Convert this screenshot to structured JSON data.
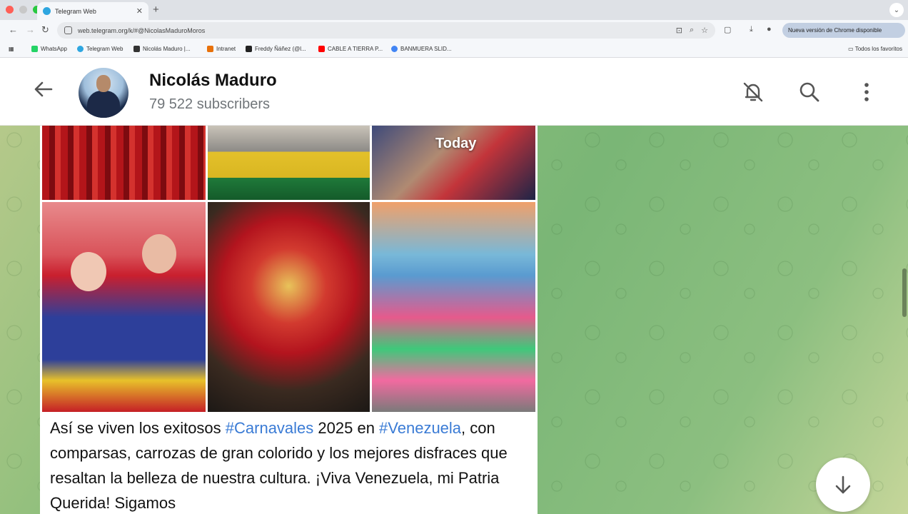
{
  "browser": {
    "tab_title": "Telegram Web",
    "url": "web.telegram.org/k/#@NicolasMaduroMoros",
    "update_button": "Nueva versión de Chrome disponible",
    "bookmarks": [
      {
        "label": "WhatsApp",
        "color": "#25d366"
      },
      {
        "label": "Telegram Web",
        "color": "#2ea6e0"
      },
      {
        "label": "Nicolás Maduro |...",
        "color": "#333333"
      },
      {
        "label": "Intranet",
        "color": "#e8710a"
      },
      {
        "label": "Freddy Ñáñez (@l...",
        "color": "#222222"
      },
      {
        "label": "CABLE A TIERRA P...",
        "color": "#ff0000"
      },
      {
        "label": "BANMUERA SLID...",
        "color": "#4285f4"
      }
    ],
    "all_bookmarks": "Todos los favoritos"
  },
  "channel": {
    "title": "Nicolás Maduro",
    "subscribers": "79 522 subscribers"
  },
  "icons": {
    "back": "arrow-left-icon",
    "mute": "bell-off-icon",
    "search": "search-icon",
    "menu": "kebab-menu-icon",
    "scroll_down": "arrow-down-icon"
  },
  "message": {
    "date_label": "Today",
    "caption_parts": {
      "p1": "Así se viven los exitosos ",
      "tag1": "#Carnavales",
      "p2": " 2025 en ",
      "tag2": "#Venezuela",
      "p3": ", con comparsas, carrozas de gran colorido y los mejores disfraces que resaltan la belleza de nuestra cultura. ¡Viva Venezuela, mi Patria Querida! Sigamos"
    }
  },
  "colors": {
    "accent": "#3a7bd5",
    "chat_bg": "#7ab676"
  }
}
